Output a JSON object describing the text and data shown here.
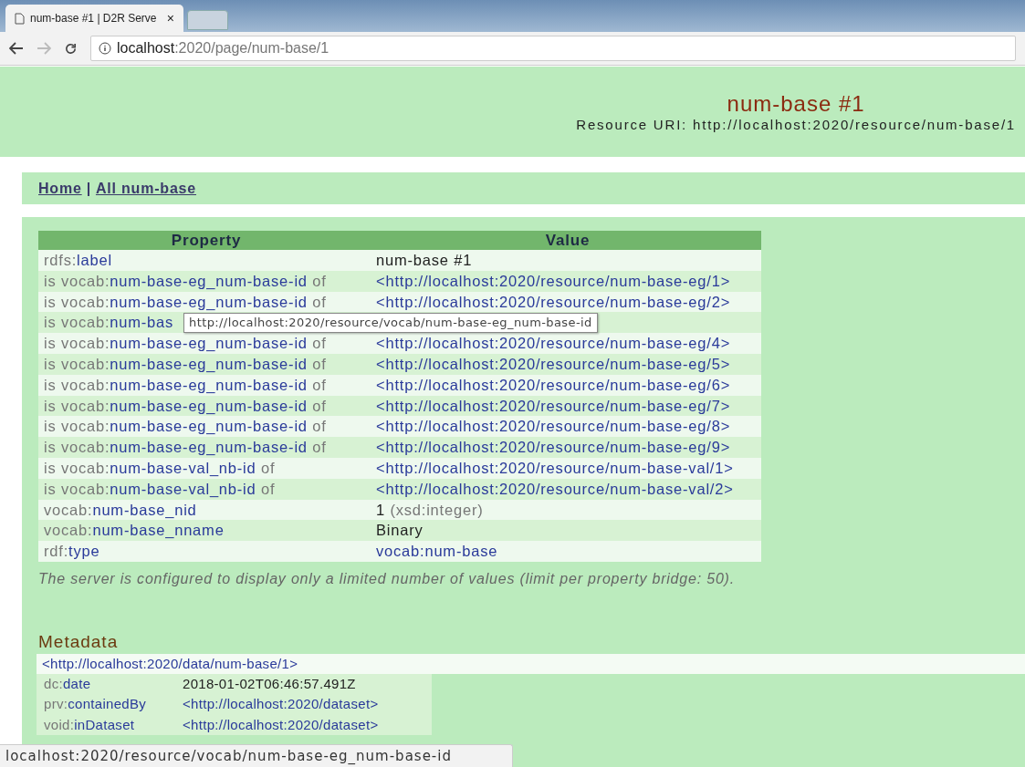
{
  "browser": {
    "tab_title": "num-base #1 | D2R Serve",
    "tab_close": "×",
    "address_host": "localhost",
    "address_path": ":2020/page/num-base/1"
  },
  "header": {
    "title": "num-base #1",
    "resource_label": "Resource URI:",
    "resource_uri": "http://localhost:2020/resource/num-base/1"
  },
  "nav": {
    "links": [
      "Home",
      "All num-base"
    ],
    "separator": "|"
  },
  "table": {
    "columns": [
      "Property",
      "Value"
    ],
    "rows": [
      {
        "property": {
          "pre": "rdfs:",
          "local": "label"
        },
        "value": {
          "kind": "literal",
          "text": "num-base #1"
        }
      },
      {
        "property": {
          "pre": "is vocab:",
          "local": "num-base-eg_num-base-id",
          "post": " of"
        },
        "value": {
          "kind": "link",
          "text": "<http://localhost:2020/resource/num-base-eg/1>"
        }
      },
      {
        "property": {
          "pre": "is vocab:",
          "local": "num-base-eg_num-base-id",
          "post": " of"
        },
        "value": {
          "kind": "link",
          "text": "<http://localhost:2020/resource/num-base-eg/2>"
        }
      },
      {
        "property": {
          "pre": "is vocab:",
          "local": "num-bas"
        }
      },
      {
        "property": {
          "pre": "is vocab:",
          "local": "num-base-eg_num-base-id",
          "post": " of"
        },
        "value": {
          "kind": "link",
          "text": "<http://localhost:2020/resource/num-base-eg/4>"
        }
      },
      {
        "property": {
          "pre": "is vocab:",
          "local": "num-base-eg_num-base-id",
          "post": " of"
        },
        "value": {
          "kind": "link",
          "text": "<http://localhost:2020/resource/num-base-eg/5>"
        }
      },
      {
        "property": {
          "pre": "is vocab:",
          "local": "num-base-eg_num-base-id",
          "post": " of"
        },
        "value": {
          "kind": "link",
          "text": "<http://localhost:2020/resource/num-base-eg/6>"
        }
      },
      {
        "property": {
          "pre": "is vocab:",
          "local": "num-base-eg_num-base-id",
          "post": " of"
        },
        "value": {
          "kind": "link",
          "text": "<http://localhost:2020/resource/num-base-eg/7>"
        }
      },
      {
        "property": {
          "pre": "is vocab:",
          "local": "num-base-eg_num-base-id",
          "post": " of"
        },
        "value": {
          "kind": "link",
          "text": "<http://localhost:2020/resource/num-base-eg/8>"
        }
      },
      {
        "property": {
          "pre": "is vocab:",
          "local": "num-base-eg_num-base-id",
          "post": " of"
        },
        "value": {
          "kind": "link",
          "text": "<http://localhost:2020/resource/num-base-eg/9>"
        }
      },
      {
        "property": {
          "pre": "is vocab:",
          "local": "num-base-val_nb-id",
          "post": " of"
        },
        "value": {
          "kind": "link",
          "text": "<http://localhost:2020/resource/num-base-val/1>"
        }
      },
      {
        "property": {
          "pre": "is vocab:",
          "local": "num-base-val_nb-id",
          "post": " of"
        },
        "value": {
          "kind": "link",
          "text": "<http://localhost:2020/resource/num-base-val/2>"
        }
      },
      {
        "property": {
          "pre": "vocab:",
          "local": "num-base_nid"
        },
        "value": {
          "kind": "typed",
          "text": "1",
          "datatype": "(xsd:integer)"
        }
      },
      {
        "property": {
          "pre": "vocab:",
          "local": "num-base_nname"
        },
        "value": {
          "kind": "literal",
          "text": "Binary"
        }
      },
      {
        "property": {
          "pre": "rdf:",
          "local": "type"
        },
        "value": {
          "kind": "link",
          "text": "vocab:num-base"
        }
      }
    ]
  },
  "note": "The server is configured to display only a limited number of values (limit per property bridge: 50).",
  "metadata": {
    "heading": "Metadata",
    "subject": "<http://localhost:2020/data/num-base/1>",
    "rows": [
      {
        "pre": "dc:",
        "local": "date",
        "value": {
          "kind": "literal",
          "text": "2018-01-02T06:46:57.491Z"
        }
      },
      {
        "pre": "prv:",
        "local": "containedBy",
        "value": {
          "kind": "link",
          "text": "<http://localhost:2020/dataset>"
        }
      },
      {
        "pre": "void:",
        "local": "inDataset",
        "value": {
          "kind": "link",
          "text": "<http://localhost:2020/dataset>"
        }
      }
    ]
  },
  "tooltip": "http://localhost:2020/resource/vocab/num-base-eg_num-base-id",
  "status_bar": "localhost:2020/resource/vocab/num-base-eg_num-base-id"
}
